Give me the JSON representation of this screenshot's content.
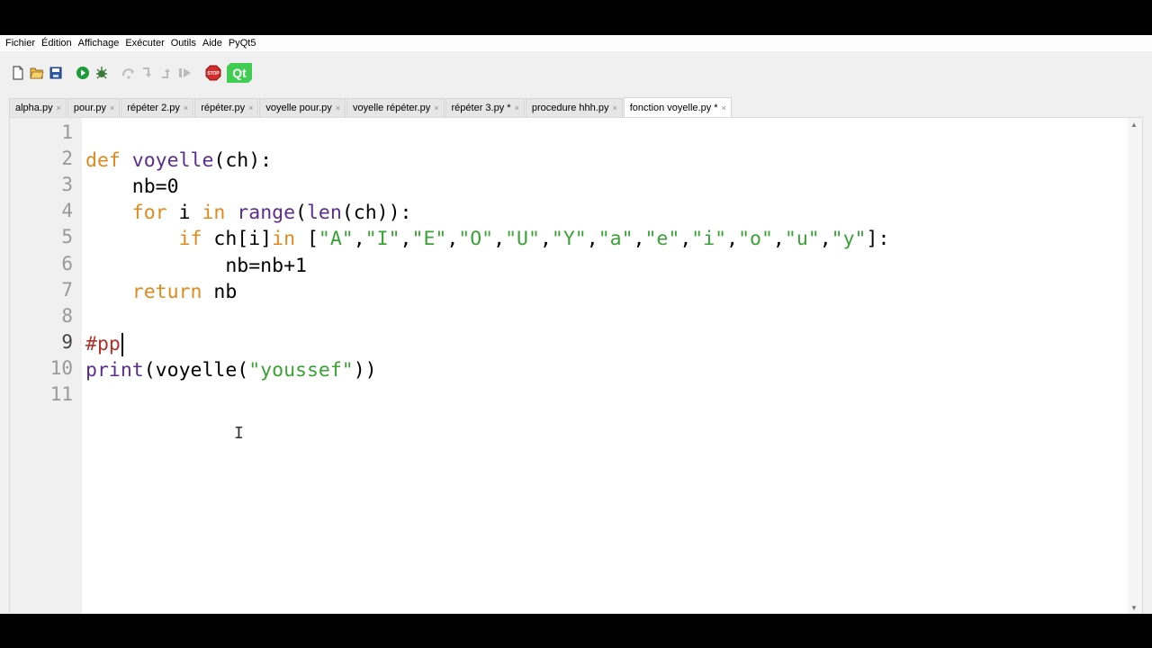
{
  "menu": [
    "Fichier",
    "Édition",
    "Affichage",
    "Exécuter",
    "Outils",
    "Aide",
    "PyQt5"
  ],
  "toolbar": {
    "icons": [
      "new-file-icon",
      "open-folder-icon",
      "save-icon",
      "run-icon",
      "debug-icon",
      "step-over-icon",
      "step-into-icon",
      "step-out-icon",
      "resume-icon",
      "stop-icon",
      "qt-icon"
    ],
    "stop_label": "STOP",
    "qt_label": "Qt"
  },
  "tabs": [
    {
      "label": "alpha.py",
      "active": false
    },
    {
      "label": "pour.py",
      "active": false
    },
    {
      "label": "répéter 2.py",
      "active": false
    },
    {
      "label": "répéter.py",
      "active": false
    },
    {
      "label": "voyelle pour.py",
      "active": false
    },
    {
      "label": "voyelle répéter.py",
      "active": false
    },
    {
      "label": "répéter 3.py *",
      "active": false
    },
    {
      "label": "procedure hhh.py",
      "active": false
    },
    {
      "label": "fonction voyelle.py *",
      "active": true
    }
  ],
  "tab_close": "×",
  "editor": {
    "line_numbers": [
      "1",
      "2",
      "3",
      "4",
      "5",
      "6",
      "7",
      "8",
      "9",
      "10",
      "11"
    ],
    "current_line": "9",
    "lines": [
      {
        "indent": "",
        "tokens": []
      },
      {
        "indent": "",
        "tokens": [
          [
            "kw",
            "def"
          ],
          [
            "",
            " "
          ],
          [
            "fn",
            "voyelle"
          ],
          [
            "",
            "(ch):"
          ]
        ]
      },
      {
        "indent": "    ",
        "tokens": [
          [
            "",
            "nb=0"
          ]
        ]
      },
      {
        "indent": "    ",
        "tokens": [
          [
            "kw",
            "for"
          ],
          [
            "",
            " i "
          ],
          [
            "kw",
            "in"
          ],
          [
            "",
            ""
          ],
          [
            "fn",
            " range"
          ],
          [
            "",
            "("
          ],
          [
            "fn",
            "len"
          ],
          [
            "",
            "(ch)):"
          ]
        ]
      },
      {
        "indent": "        ",
        "tokens": [
          [
            "kw",
            "if"
          ],
          [
            "",
            " ch[i]"
          ],
          [
            "kw",
            "in"
          ],
          [
            "",
            " ["
          ],
          [
            "str",
            "\"A\""
          ],
          [
            "",
            ","
          ],
          [
            "str",
            "\"I\""
          ],
          [
            "",
            ","
          ],
          [
            "str",
            "\"E\""
          ],
          [
            "",
            ","
          ],
          [
            "str",
            "\"O\""
          ],
          [
            "",
            ","
          ],
          [
            "str",
            "\"U\""
          ],
          [
            "",
            ","
          ],
          [
            "str",
            "\"Y\""
          ],
          [
            "",
            ","
          ],
          [
            "str",
            "\"a\""
          ],
          [
            "",
            ","
          ],
          [
            "str",
            "\"e\""
          ],
          [
            "",
            ","
          ],
          [
            "str",
            "\"i\""
          ],
          [
            "",
            ","
          ],
          [
            "str",
            "\"o\""
          ],
          [
            "",
            ","
          ],
          [
            "str",
            "\"u\""
          ],
          [
            "",
            ","
          ],
          [
            "str",
            "\"y\""
          ],
          [
            "",
            "]:"
          ]
        ]
      },
      {
        "indent": "            ",
        "tokens": [
          [
            "",
            "nb=nb+1"
          ]
        ]
      },
      {
        "indent": "    ",
        "tokens": [
          [
            "kw",
            "return"
          ],
          [
            "",
            " nb"
          ]
        ]
      },
      {
        "indent": "",
        "tokens": []
      },
      {
        "indent": "",
        "tokens": [
          [
            "cmt",
            "#pp"
          ]
        ]
      },
      {
        "indent": "",
        "tokens": [
          [
            "fn",
            "print"
          ],
          [
            "",
            "(voyelle("
          ],
          [
            "str",
            "\"youssef\""
          ],
          [
            "",
            "))"
          ]
        ]
      },
      {
        "indent": "",
        "tokens": []
      }
    ]
  },
  "colors": {
    "keyword": "#e08a1e",
    "builtin": "#5c2d91",
    "string": "#3aa235",
    "comment": "#b0312a"
  }
}
